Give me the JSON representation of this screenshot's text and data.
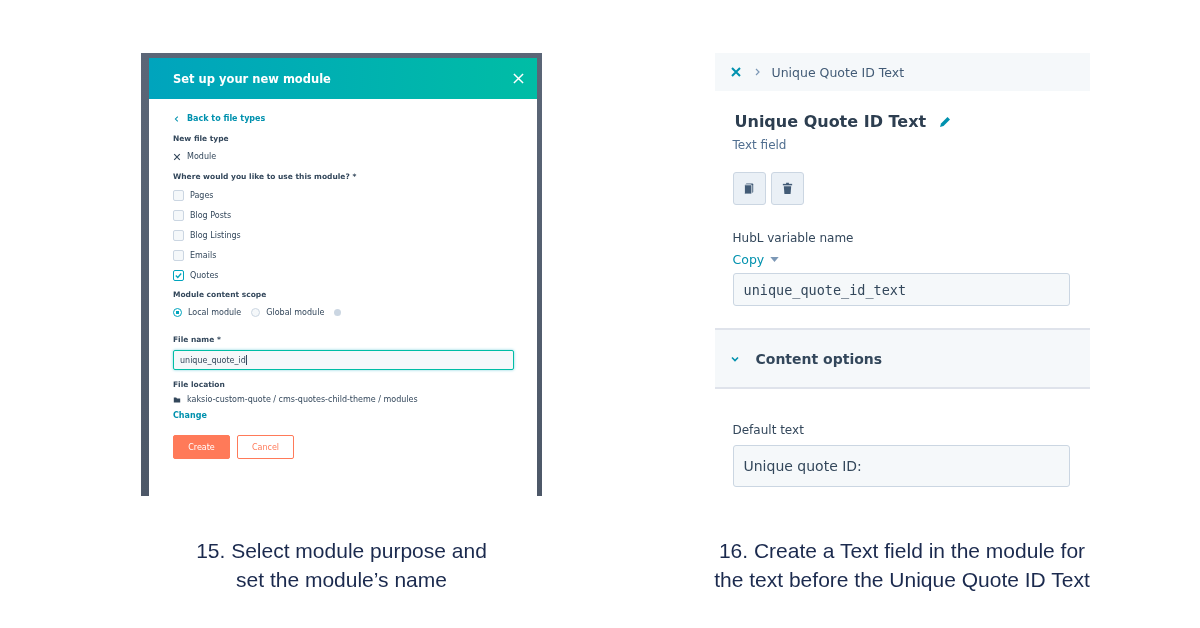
{
  "steps": [
    {
      "caption": "15. Select module purpose and set the module’s name",
      "dialog": {
        "title": "Set up your new module",
        "back_link": "Back to file types",
        "file_type_label": "New file type",
        "file_type_value": "Module",
        "usage_question": "Where would you like to use this module? *",
        "usage_options": [
          {
            "label": "Pages",
            "checked": false
          },
          {
            "label": "Blog Posts",
            "checked": false
          },
          {
            "label": "Blog Listings",
            "checked": false
          },
          {
            "label": "Emails",
            "checked": false
          },
          {
            "label": "Quotes",
            "checked": true
          }
        ],
        "scope_label": "Module content scope",
        "scope_options": [
          {
            "label": "Local module",
            "selected": true
          },
          {
            "label": "Global module",
            "selected": false
          }
        ],
        "file_name_label": "File name *",
        "file_name_value": "unique_quote_id",
        "file_location_label": "File location",
        "file_location_path": "kaksio-custom-quote / cms-quotes-child-theme / modules",
        "change_link": "Change",
        "buttons": [
          {
            "label": "Create",
            "kind": "primary"
          },
          {
            "label": "Cancel",
            "kind": "secondary"
          }
        ]
      }
    },
    {
      "caption": "16. Create a Text field in the module for the text before the Unique Quote ID Text",
      "editor": {
        "breadcrumb": "Unique Quote ID Text",
        "title": "Unique Quote ID Text",
        "subtitle": "Text field",
        "variable_label": "HubL variable name",
        "copy_menu": "Copy",
        "variable_value": "unique_quote_id_text",
        "section": {
          "title": "Content options",
          "expanded": true
        },
        "default_label": "Default text",
        "default_value": "Unique quote ID:"
      }
    }
  ]
}
